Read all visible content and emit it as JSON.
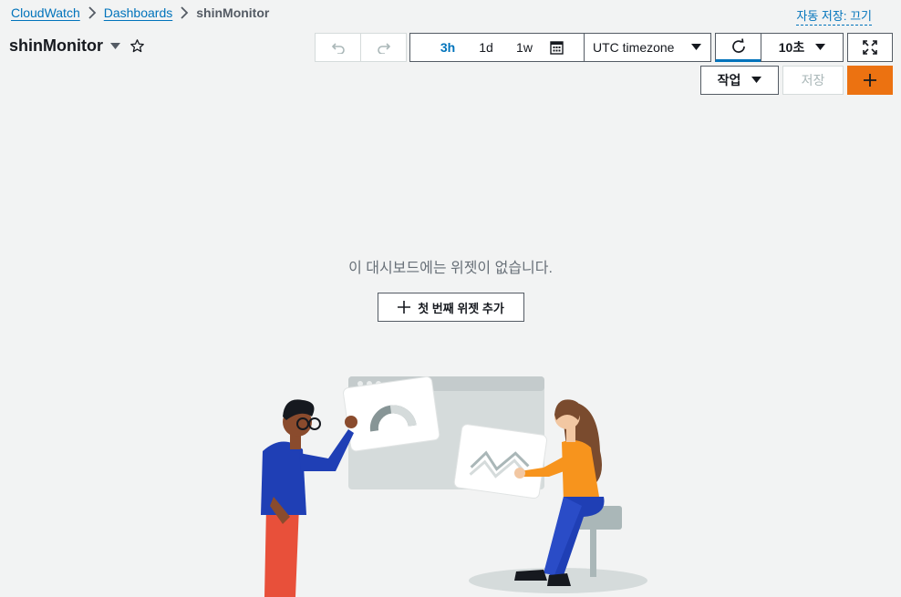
{
  "breadcrumb": {
    "items": [
      {
        "label": "CloudWatch"
      },
      {
        "label": "Dashboards"
      }
    ],
    "current": "shinMonitor"
  },
  "autosave": {
    "label": "자동 저장: 끄기"
  },
  "dashboard": {
    "title": "shinMonitor"
  },
  "toolbar": {
    "ranges": [
      "3h",
      "1d",
      "1w"
    ],
    "active_range": "3h",
    "timezone": "UTC timezone",
    "interval": "10초",
    "actions_label": "작업",
    "save_label": "저장",
    "add_label": "+"
  },
  "empty_state": {
    "message": "이 대시보드에는 위젯이 없습니다.",
    "button_label": "첫 번째 위젯 추가"
  },
  "colors": {
    "link": "#0073bb",
    "accent": "#ec7211",
    "background": "#f2f3f3"
  },
  "icons": [
    "chevron-right-icon",
    "caret-down-icon",
    "star-icon",
    "undo-icon",
    "redo-icon",
    "calendar-icon",
    "refresh-icon",
    "fullscreen-icon",
    "plus-icon"
  ]
}
